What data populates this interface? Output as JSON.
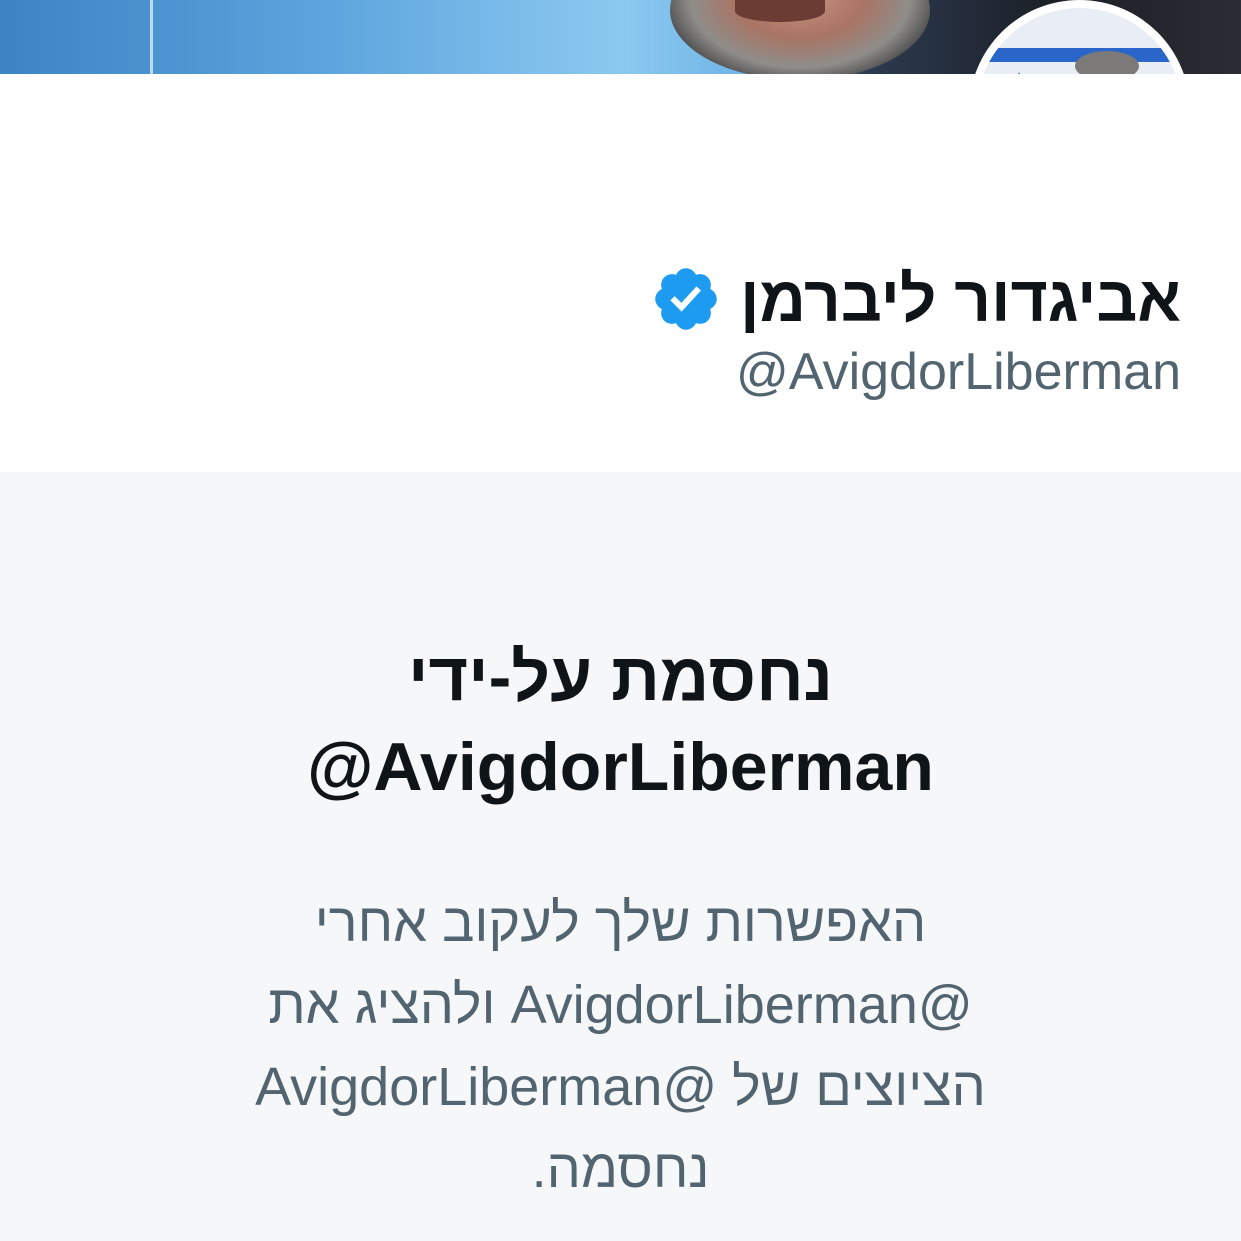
{
  "profile": {
    "display_name": "אביגדור ליברמן",
    "handle": "@AvigdorLiberman",
    "verified": true
  },
  "blocked": {
    "title_line1": "נחסמת על-ידי",
    "title_line2": "@AvigdorLiberman",
    "description_lines": [
      "האפשרות שלך לעקוב אחרי",
      "@AvigdorLiberman ולהציג את",
      "הציוצים של @AvigdorLiberman",
      "נחסמה."
    ]
  },
  "icons": {
    "verified": "verified-badge-icon"
  },
  "colors": {
    "verified_blue": "#1d9bf0",
    "text_primary": "#0f1419",
    "text_secondary": "#536471",
    "panel_background": "#f6f7f9"
  }
}
